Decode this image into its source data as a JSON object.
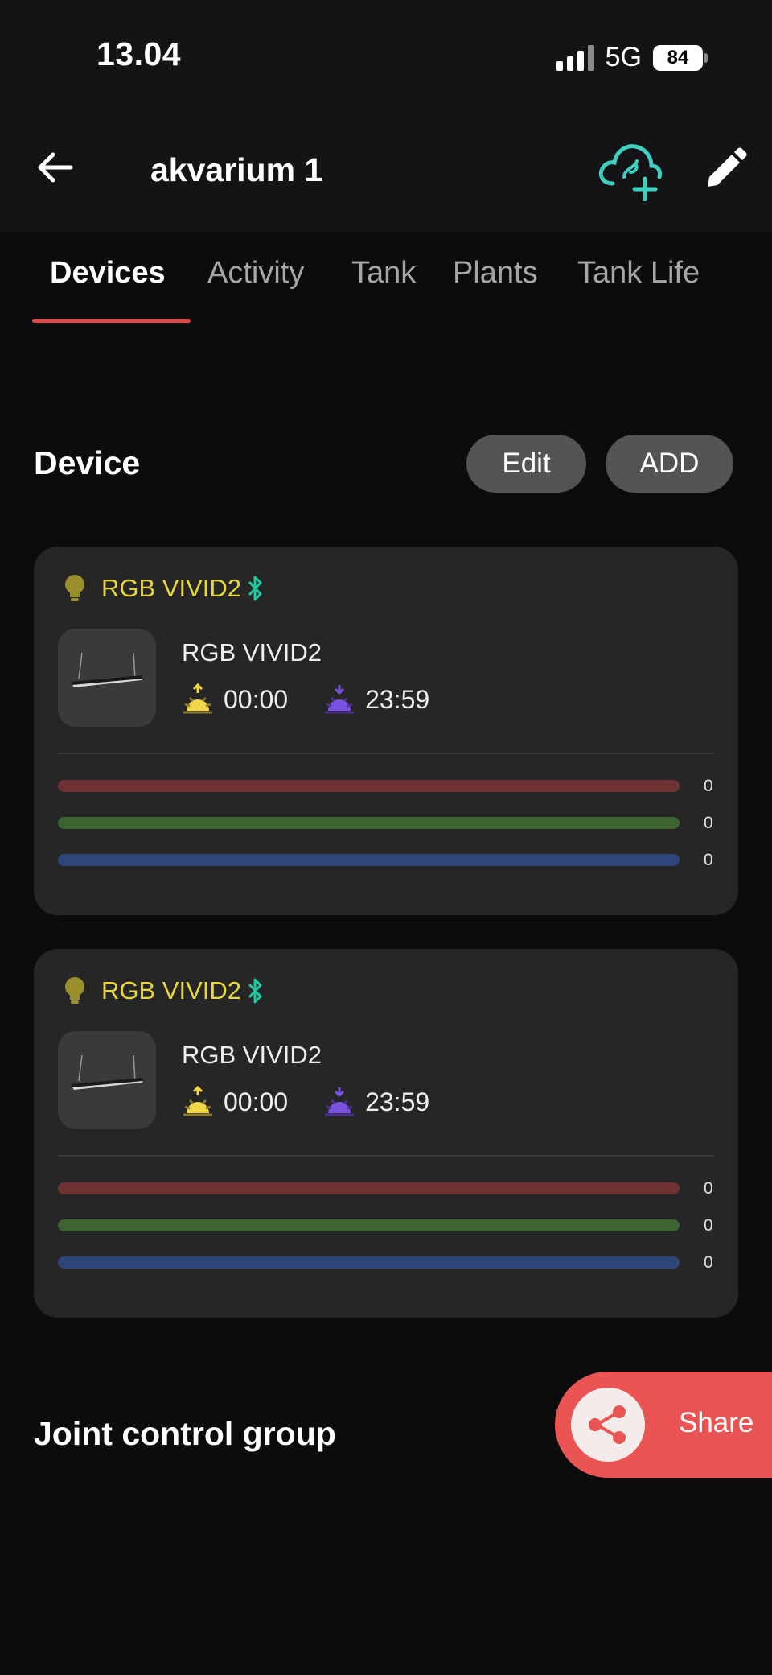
{
  "status_bar": {
    "time": "13.04",
    "network": "5G",
    "battery": "84"
  },
  "header": {
    "title": "akvarium 1"
  },
  "tabs": [
    {
      "label": "Devices",
      "active": true
    },
    {
      "label": "Activity",
      "active": false
    },
    {
      "label": "Tank",
      "active": false
    },
    {
      "label": "Plants",
      "active": false
    },
    {
      "label": "Tank Life",
      "active": false
    }
  ],
  "device_section": {
    "title": "Device",
    "edit_label": "Edit",
    "add_label": "ADD"
  },
  "devices": [
    {
      "name": "RGB VIVID2",
      "model": "RGB VIVID2",
      "sunrise": "00:00",
      "sunset": "23:59",
      "channels": {
        "red": "0",
        "green": "0",
        "blue": "0"
      }
    },
    {
      "name": "RGB VIVID2",
      "model": "RGB VIVID2",
      "sunrise": "00:00",
      "sunset": "23:59",
      "channels": {
        "red": "0",
        "green": "0",
        "blue": "0"
      }
    }
  ],
  "joint_section": {
    "title": "Joint control group"
  },
  "share": {
    "label": "Share"
  },
  "colors": {
    "accent_red": "#e0484a",
    "device_name": "#e8d63a",
    "bluetooth": "#1fc9a0",
    "cloud": "#3ecfc0",
    "share_bg": "#ea5452"
  }
}
